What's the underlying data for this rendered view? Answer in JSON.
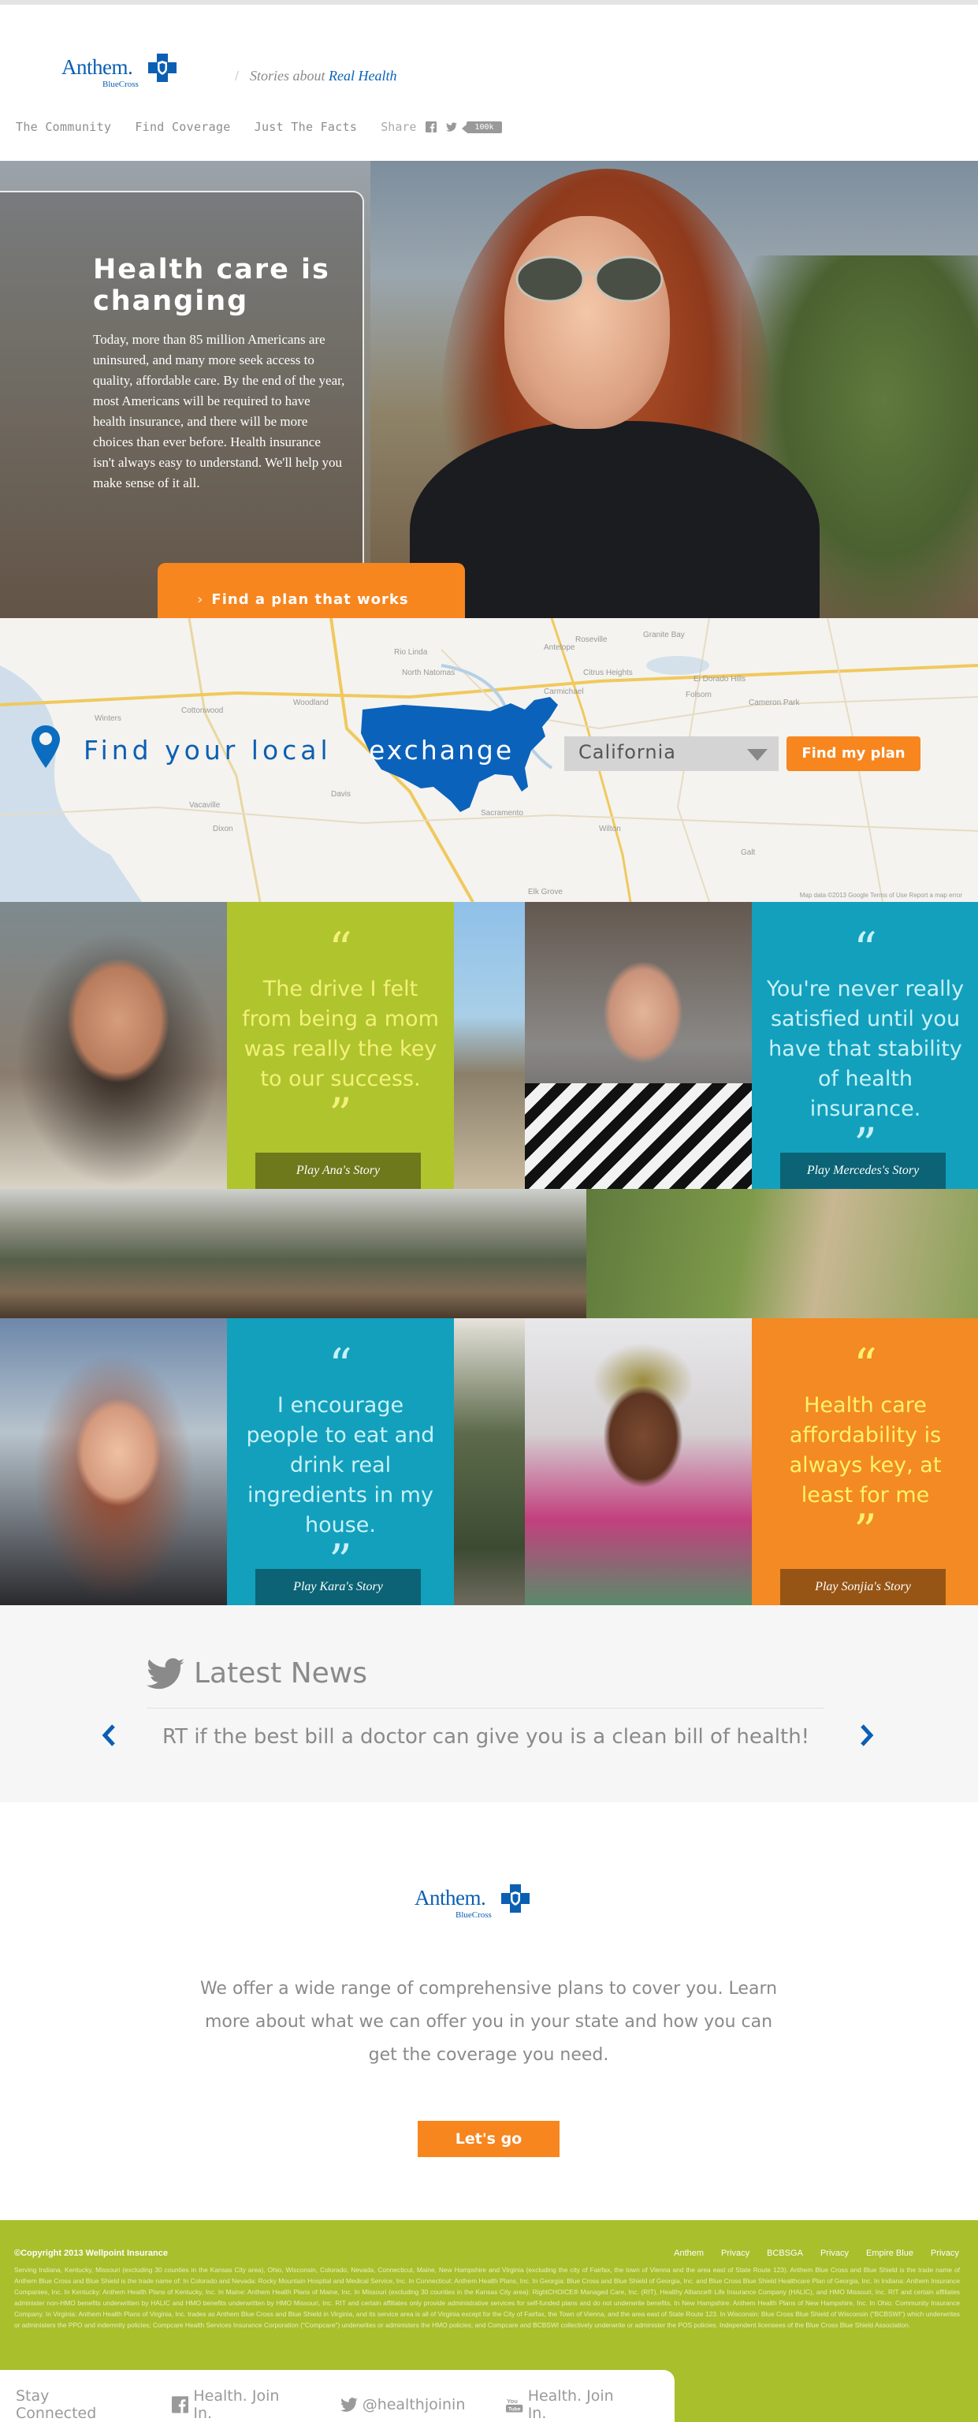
{
  "header": {
    "logo": {
      "brand": "Anthem.",
      "sub": "BlueCross"
    },
    "tagline_prefix": "Stories about",
    "tagline_highlight": "Real Health",
    "nav": [
      "The Community",
      "Find Coverage",
      "Just The Facts"
    ],
    "share_label": "Share",
    "share_count": "100k"
  },
  "hero": {
    "title": "Health care is changing",
    "text": "Today, more than 85 million Americans are uninsured, and many more seek access to quality, affordable care. By the end of the year, most Americans will be required to have health insurance, and there will be more choices than ever before. Health insurance isn't always easy to understand. We'll help you make sense of it all.",
    "cta": "Find a plan that works"
  },
  "exchange": {
    "title": "Find your local",
    "title_highlight": "exchange",
    "state": "California",
    "button": "Find my plan",
    "map_credit": "Map data ©2013 Google   Terms of Use   Report a map error",
    "place_labels": [
      "Woodland",
      "North Natomas",
      "Rio Linda",
      "Antelope",
      "Roseville",
      "Granite Bay",
      "Citrus Heights",
      "Folsom",
      "El Dorado Hills",
      "Cameron Park",
      "Carmichael",
      "Davis",
      "Sacramento",
      "Elk Grove",
      "Dixon",
      "Winters",
      "Vacaville",
      "Galt",
      "Wilton",
      "Cottonwood"
    ]
  },
  "stories": [
    {
      "quote": "The drive I felt from being a mom was really the key to our success.",
      "button": "Play Ana's Story",
      "color": "#b0c42d"
    },
    {
      "quote": "You're never really satisfied until you have that stability of health insurance.",
      "button": "Play Mercedes's Story",
      "color": "#12a0bd"
    },
    {
      "quote": "I encourage people to eat and drink real ingredients in my house.",
      "button": "Play Kara's Story",
      "color": "#12a0bd"
    },
    {
      "quote": "Health care affordability is always key, at least for me",
      "button": "Play Sonjia's Story",
      "color": "#f38a23"
    }
  ],
  "news": {
    "title": "Latest News",
    "tweet": "RT if the best bill a doctor can give you is a clean bill of health!"
  },
  "promo": {
    "text": "We offer a wide range of comprehensive plans to cover you. Learn more about what we can offer you in your state and how you can get the coverage you need.",
    "button": "Let's go"
  },
  "footer": {
    "copyright": "©Copyright 2013 Wellpoint Insurance",
    "links": [
      "Anthem",
      "Privacy",
      "BCBSGA",
      "Privacy",
      "Empire Blue",
      "Privacy"
    ],
    "legal": "Serving Indiana, Kentucky, Missouri (excluding 30 counties in the Kansas City area), Ohio, Wisconsin, Colorado, Nevada, Connecticut, Maine, New Hampshire and Virginia (excluding the city of Fairfax, the town of Vienna and the area east of State Route 123). Anthem Blue Cross and Blue Shield is the trade name of Anthem Blue Cross and Blue Shield is the trade name of: In Colorado and Nevada: Rocky Mountain Hospital and Medical Service, Inc. In Connecticut: Anthem Health Plans, Inc. In Georgia: Blue Cross and Blue Shield of Georgia, Inc. and Blue Cross Blue Shield Healthcare Plan of Georgia, Inc. In Indiana: Anthem Insurance Companies, Inc. In Kentucky: Anthem Health Plans of Kentucky, Inc. In Maine: Anthem Health Plans of Maine, Inc. In Missouri (excluding 30 counties in the Kansas City area): RightCHOICE® Managed Care, Inc. (RIT), Healthy Alliance® Life Insurance Company (HALIC), and HMO Missouri, Inc. RIT and certain affiliates administer non-HMO benefits underwritten by HALIC and HMO benefits underwritten by HMO Missouri, Inc. RIT and certain affiliates only provide administrative services for self-funded plans and do not underwrite benefits. In New Hampshire: Anthem Health Plans of New Hampshire, Inc. In Ohio: Community Insurance Company. In Virginia: Anthem Health Plans of Virginia, Inc. trades as Anthem Blue Cross and Blue Shield in Virginia, and its service area is all of Virginia except for the City of Fairfax, the Town of Vienna, and the area east of State Route 123. In Wisconsin: Blue Cross Blue Shield of Wisconsin (\"BCBSWI\") which underwrites or administers the PPO and indemnity policies; Compcare Health Services Insurance Corporation (\"Compcare\") underwrites or administers the HMO policies; and Compcare and BCBSWI collectively underwrite or administer the POS policies. Independent licensees of the Blue Cross Blue Shield Association.",
    "stay": "Stay Connected",
    "facebook": "Health. Join In.",
    "twitter": "@healthjoinin",
    "youtube": "Health. Join In."
  }
}
